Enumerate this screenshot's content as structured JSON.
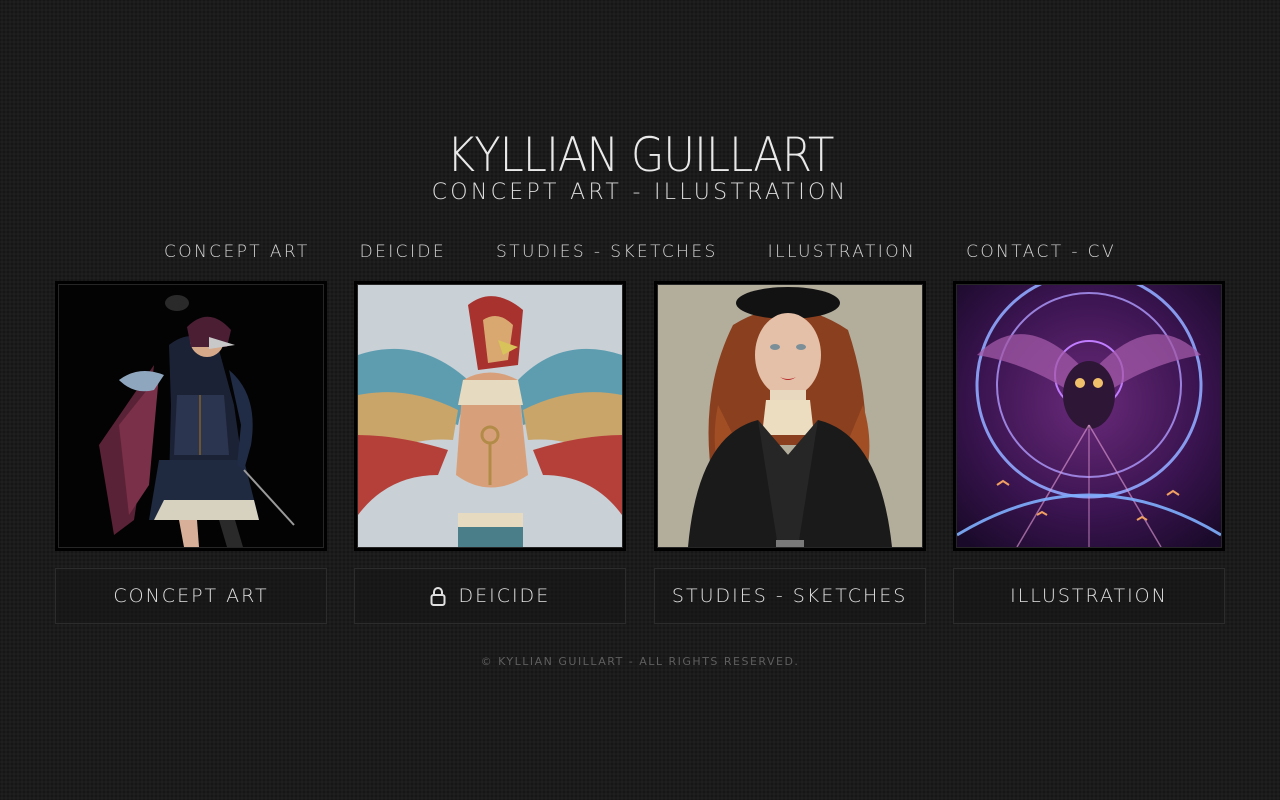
{
  "header": {
    "title": "KYLLIAN GUILLART",
    "subtitle": "CONCEPT ART - ILLUSTRATION"
  },
  "nav": {
    "items": [
      {
        "label": "CONCEPT ART"
      },
      {
        "label": "DEICIDE"
      },
      {
        "label": "STUDIES - SKETCHES"
      },
      {
        "label": "ILLUSTRATION"
      },
      {
        "label": "CONTACT - CV"
      }
    ]
  },
  "gallery": {
    "cards": [
      {
        "label": "CONCEPT ART",
        "image": "crow-masked-warrior-illustration"
      },
      {
        "label": "DEICIDE",
        "image": "falcon-headed-god-illustration",
        "icon": "lock-icon"
      },
      {
        "label": "STUDIES - SKETCHES",
        "image": "woman-in-beret-portrait"
      },
      {
        "label": "ILLUSTRATION",
        "image": "owl-mandala-illustration"
      }
    ]
  },
  "footer": {
    "copyright": "© KYLLIAN GUILLART - ALL RIGHTS RESERVED."
  },
  "colors": {
    "background": "#1b1b1b",
    "text": "#e0e0e0",
    "footer_text": "#5e5e5e"
  }
}
